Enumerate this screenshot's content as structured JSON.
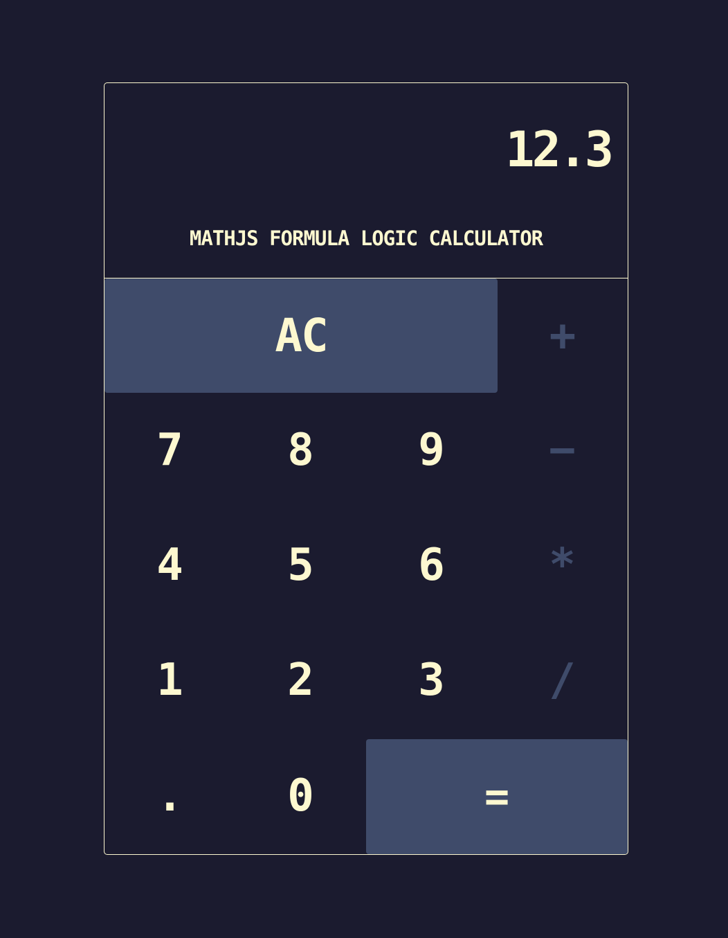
{
  "display": {
    "value": "12.3",
    "title": "MATHJS FORMULA LOGIC CALCULATOR"
  },
  "keys": {
    "clear": "AC",
    "add": "+",
    "subtract": "−",
    "multiply": "*",
    "divide": "/",
    "seven": "7",
    "eight": "8",
    "nine": "9",
    "four": "4",
    "five": "5",
    "six": "6",
    "one": "1",
    "two": "2",
    "three": "3",
    "decimal": ".",
    "zero": "0",
    "equals": "="
  },
  "colors": {
    "background": "#1b1b2f",
    "text": "#fdf8d0",
    "accent": "#3f4b6a"
  }
}
